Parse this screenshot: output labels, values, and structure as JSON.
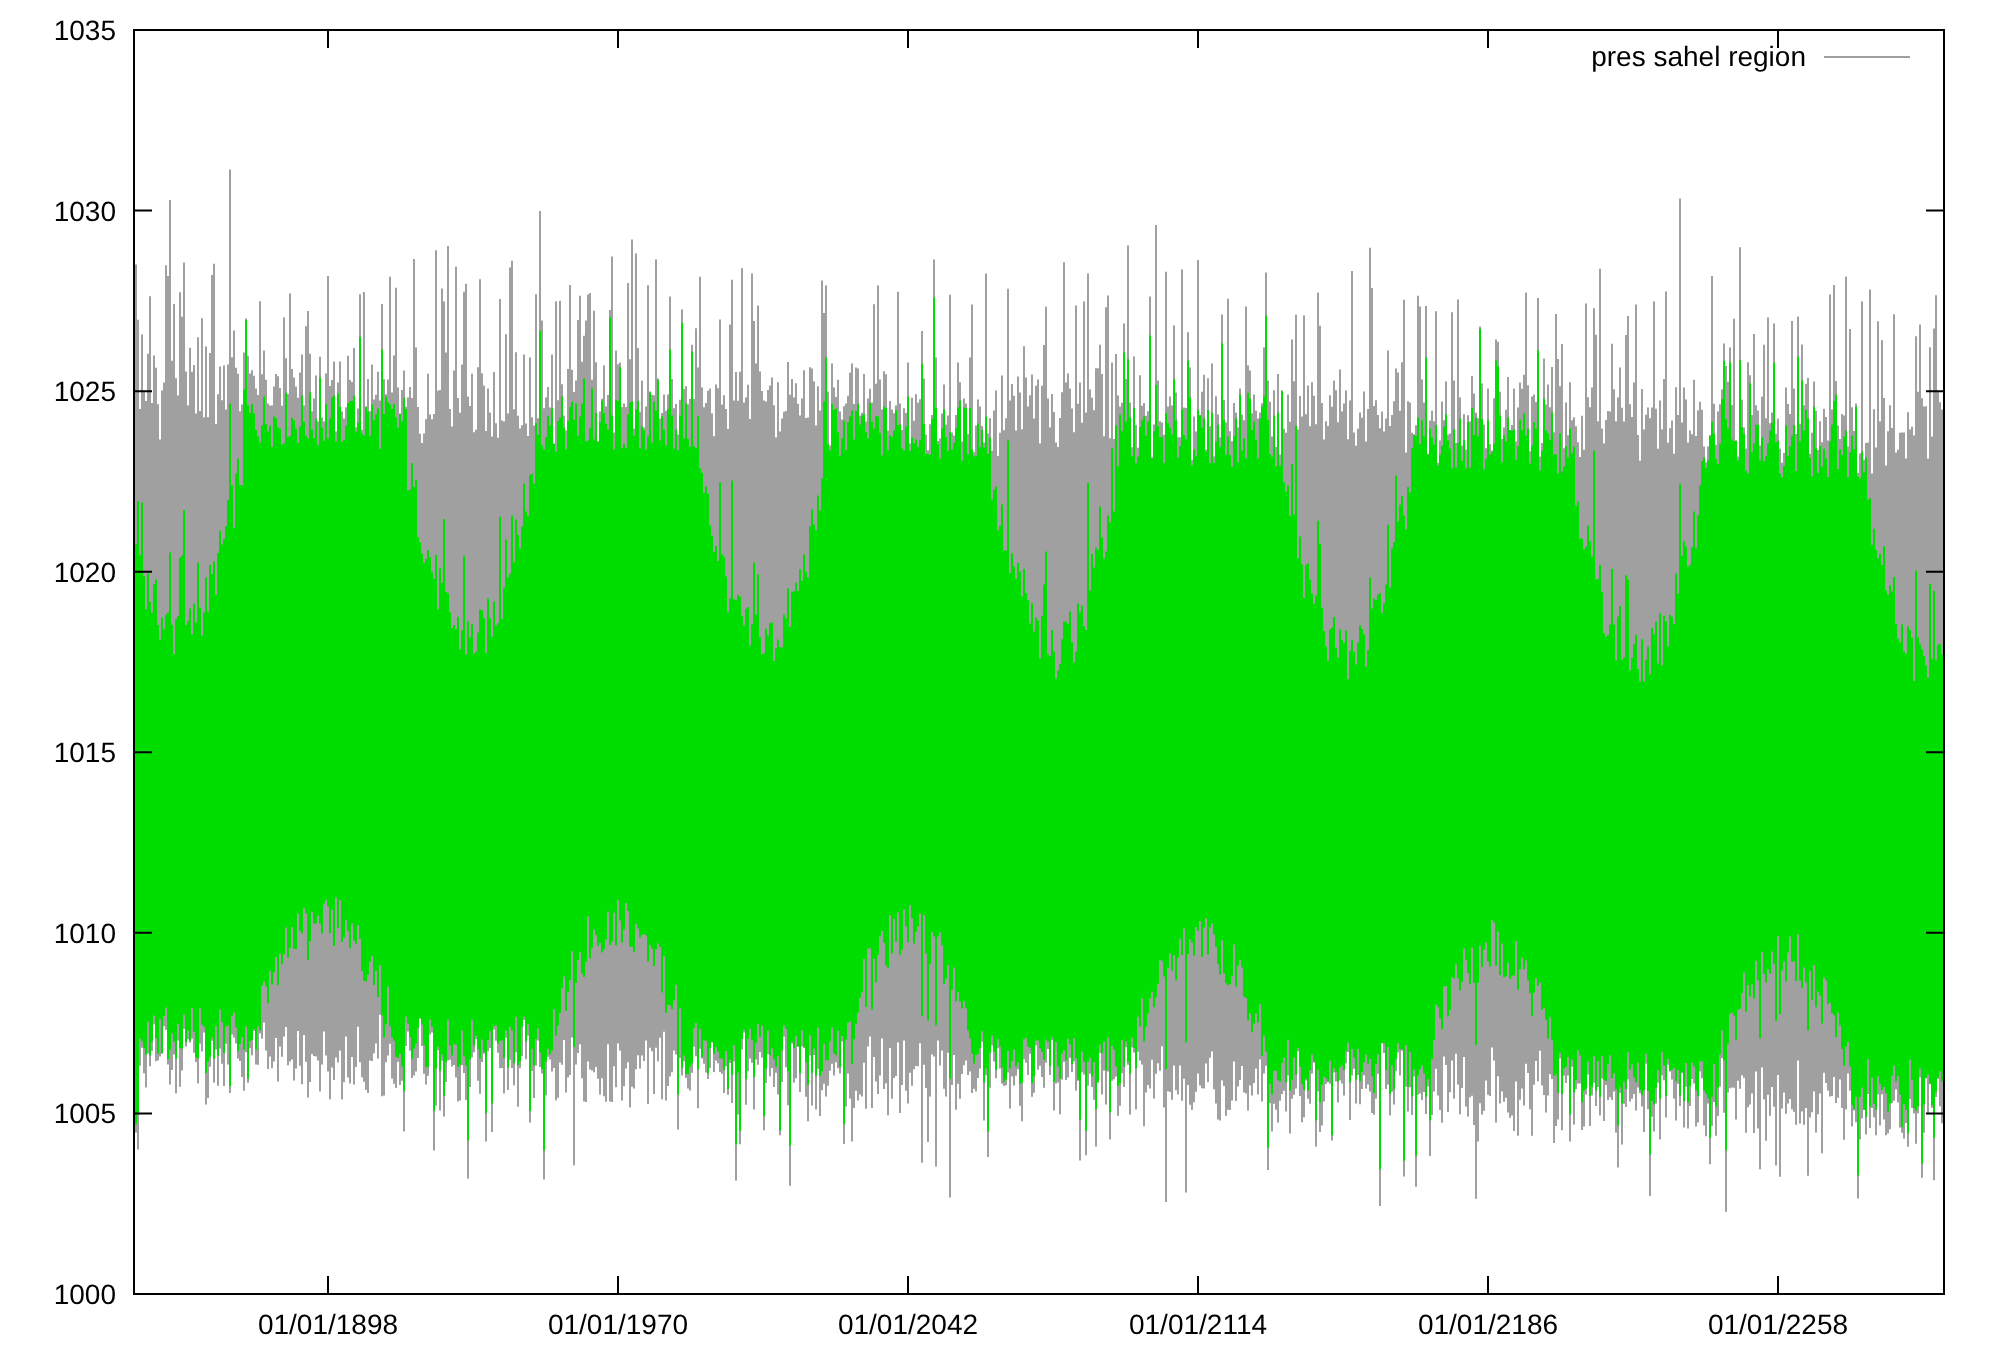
{
  "chart": {
    "legend": {
      "label": "pres sahel region"
    },
    "y_tick_labels": [
      "1035",
      "1030",
      "1025",
      "1020",
      "1015",
      "1010",
      "1005",
      "1000"
    ],
    "x_tick_labels": [
      "01/01/1898",
      "01/01/1970",
      "01/01/2042",
      "01/01/2114",
      "01/01/2186",
      "01/01/2258"
    ]
  }
}
